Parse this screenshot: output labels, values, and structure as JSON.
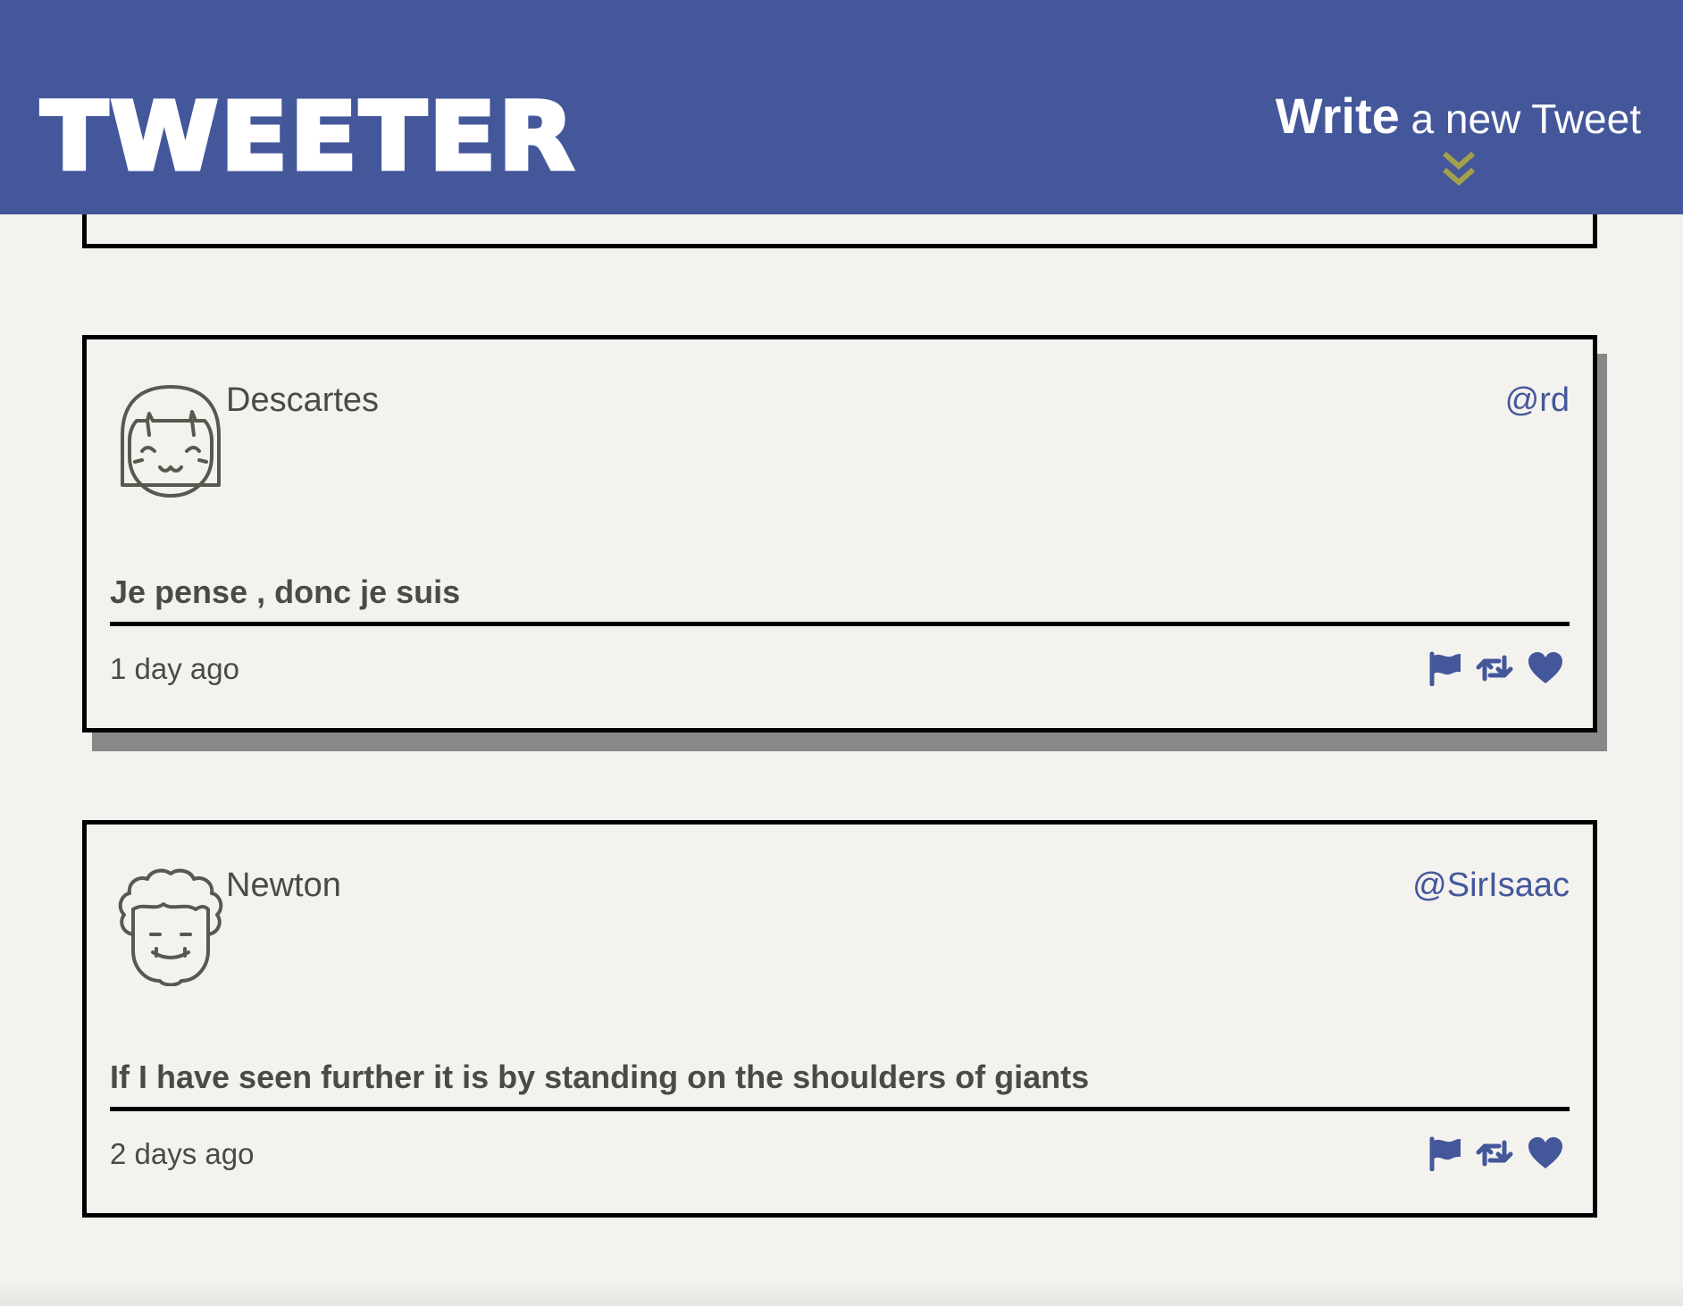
{
  "header": {
    "brand": "TWEETER",
    "write_strong": "Write",
    "write_rest": " a new Tweet",
    "toggle_icon": "double-chevron-down-icon",
    "background_color": "#44579b",
    "toggle_icon_color": "#a3a04b"
  },
  "tweets": [
    {
      "name": "Descartes",
      "handle": "@rd",
      "avatar": "girl-face-icon",
      "content": "Je pense , donc je suis",
      "time": "1 day ago",
      "actions": [
        "flag-icon",
        "retweet-icon",
        "heart-icon"
      ]
    },
    {
      "name": "Newton",
      "handle": "@SirIsaac",
      "avatar": "curly-hair-face-icon",
      "content": "If I have seen further it is by standing on the shoulders of giants",
      "time": "2 days ago",
      "actions": [
        "flag-icon",
        "retweet-icon",
        "heart-icon"
      ]
    }
  ],
  "colors": {
    "accent": "#44579b",
    "page_background": "#f3f2ee",
    "text": "#4a4a46",
    "border": "#000000",
    "shadow": "#888888"
  }
}
